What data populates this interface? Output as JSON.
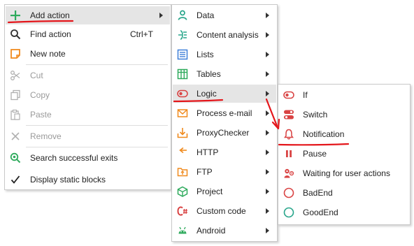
{
  "main_menu": {
    "add_action": "Add action",
    "find_action": "Find action",
    "find_action_shortcut": "Ctrl+T",
    "new_note": "New note",
    "cut": "Cut",
    "copy": "Copy",
    "paste": "Paste",
    "remove": "Remove",
    "search_exits": "Search successful exits",
    "display_static": "Display static blocks"
  },
  "action_submenu": {
    "items": [
      {
        "label": "Data",
        "icon": "database-icon"
      },
      {
        "label": "Content analysis",
        "icon": "content-analysis-icon"
      },
      {
        "label": "Lists",
        "icon": "list-icon"
      },
      {
        "label": "Tables",
        "icon": "table-icon"
      },
      {
        "label": "Logic",
        "icon": "toggle-icon"
      },
      {
        "label": "Process e-mail",
        "icon": "envelope-icon"
      },
      {
        "label": "ProxyChecker",
        "icon": "download-box-icon"
      },
      {
        "label": "HTTP",
        "icon": "http-get-icon"
      },
      {
        "label": "FTP",
        "icon": "ftp-folder-icon"
      },
      {
        "label": "Project",
        "icon": "cube-icon"
      },
      {
        "label": "Custom code",
        "icon": "csharp-icon"
      },
      {
        "label": "Android",
        "icon": "android-icon"
      }
    ]
  },
  "logic_submenu": {
    "items": [
      {
        "label": "If",
        "icon": "if-toggle-icon"
      },
      {
        "label": "Switch",
        "icon": "switch-icon"
      },
      {
        "label": "Notification",
        "icon": "bell-icon"
      },
      {
        "label": "Pause",
        "icon": "pause-icon"
      },
      {
        "label": "Waiting for user actions",
        "icon": "user-actions-icon"
      },
      {
        "label": "BadEnd",
        "icon": "bad-end-circle-icon"
      },
      {
        "label": "GoodEnd",
        "icon": "good-end-circle-icon"
      }
    ]
  },
  "colors": {
    "green": "#2eaa5c",
    "teal": "#27a58a",
    "orange": "#f08a1d",
    "red": "#d94343",
    "blue": "#3d7fd8",
    "highlight": "#e5e5e5",
    "annotation_red": "#e4161b"
  }
}
